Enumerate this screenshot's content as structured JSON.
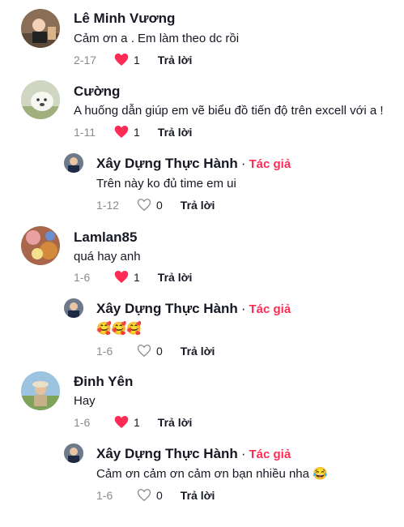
{
  "comments": [
    {
      "name": "Lê Minh Vương",
      "text": "Cảm ơn a . Em làm theo dc rồi",
      "date": "2-17",
      "likes": "1",
      "liked": true,
      "reply": "Trả lời"
    },
    {
      "name": "Cường",
      "text": "A huống dẫn giúp em vẽ biểu đồ tiến độ trên excell với a !",
      "date": "1-11",
      "likes": "1",
      "liked": true,
      "reply": "Trả lời",
      "replies": [
        {
          "name": "Xây Dựng Thực Hành",
          "sep": "·",
          "author_badge": "Tác giả",
          "text": "Trên này ko đủ time em ui",
          "date": "1-12",
          "likes": "0",
          "liked": false,
          "reply": "Trả lời"
        }
      ]
    },
    {
      "name": "Lamlan85",
      "text": "quá hay anh",
      "date": "1-6",
      "likes": "1",
      "liked": true,
      "reply": "Trả lời",
      "replies": [
        {
          "name": "Xây Dựng Thực Hành",
          "sep": "·",
          "author_badge": "Tác giả",
          "text": "🥰🥰🥰",
          "date": "1-6",
          "likes": "0",
          "liked": false,
          "reply": "Trả lời"
        }
      ]
    },
    {
      "name": "Đinh Yên",
      "text": "Hay",
      "date": "1-6",
      "likes": "1",
      "liked": true,
      "reply": "Trả lời",
      "replies": [
        {
          "name": "Xây Dựng Thực Hành",
          "sep": "·",
          "author_badge": "Tác giả",
          "text": "Cảm ơn cảm ơn cảm ơn bạn nhiều nha 😂",
          "date": "1-6",
          "likes": "0",
          "liked": false,
          "reply": "Trả lời"
        }
      ]
    }
  ],
  "colors": {
    "liked_heart": "#fe2c55",
    "author_badge": "#fe2c55",
    "meta_gray": "#8a8b91"
  }
}
